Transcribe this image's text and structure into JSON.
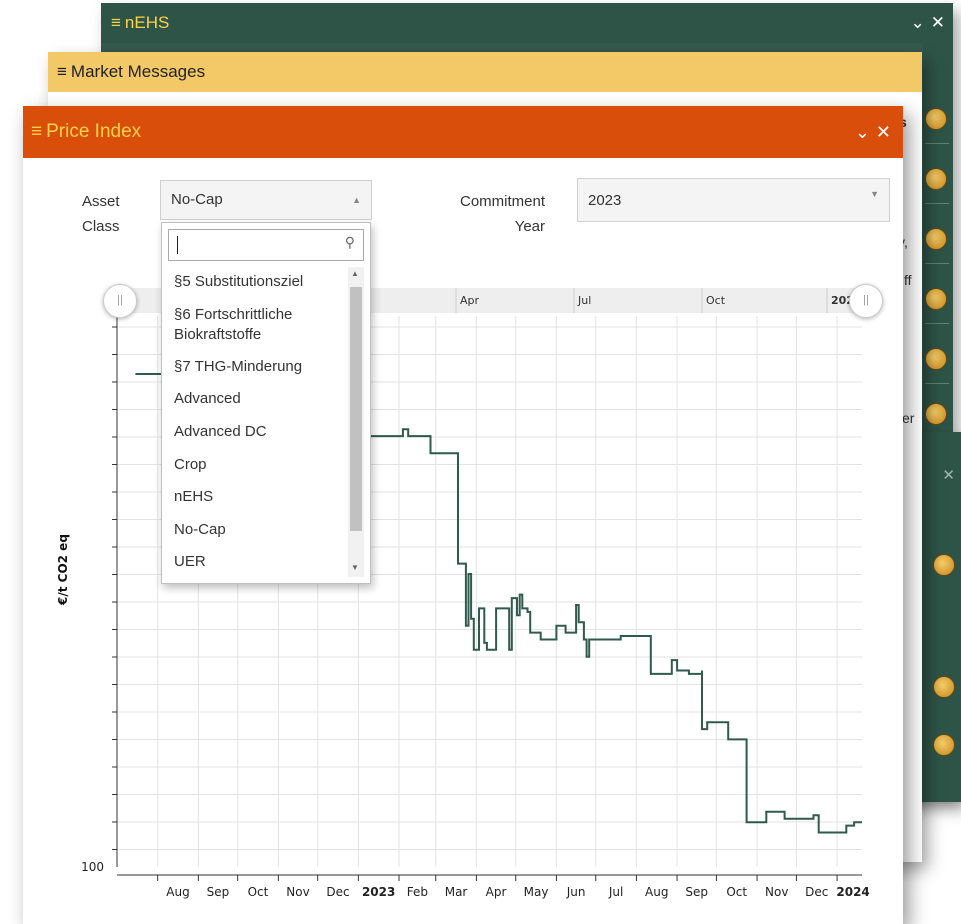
{
  "windows": {
    "nehs": {
      "title": "nEHS"
    },
    "market": {
      "title": "Market Messages",
      "partial_texts": [
        "s",
        "y,",
        "ff",
        "er"
      ]
    },
    "price": {
      "title": "Price Index",
      "asset_label": "Asset\nClass",
      "asset_value": "No-Cap",
      "commit_label": "Commitment\nYear",
      "commit_value": "2023",
      "search_value": "",
      "options": [
        "§5 Substitutionsziel",
        "§6 Fortschrittliche Biokraftstoffe",
        "§7 THG-Minderung",
        "Advanced",
        "Advanced DC",
        "Crop",
        "nEHS",
        "No-Cap",
        "UER"
      ]
    }
  },
  "icons": {
    "menu": "hamburger-icon",
    "collapse": "chevron-down-icon",
    "close": "close-icon",
    "search": "search-icon"
  },
  "colors": {
    "nehs_bar": "#2e5448",
    "market_bar": "#f3c866",
    "price_bar": "#d94e0b",
    "line": "#2f5a4d"
  },
  "chart_data": {
    "type": "line",
    "ylabel": "€/t CO2 eq",
    "y_tick_labels": [
      "100"
    ],
    "navigator_labels": [
      "Apr",
      "Jul",
      "Oct",
      "202"
    ],
    "x_tick_labels": [
      "Aug",
      "Sep",
      "Oct",
      "Nov",
      "Dec",
      "2023",
      "Feb",
      "Mar",
      "Apr",
      "May",
      "Jun",
      "Jul",
      "Aug",
      "Sep",
      "Oct",
      "Nov",
      "Dec",
      "2024"
    ],
    "series": [
      {
        "points": [
          [
            "2022-07-15",
            243
          ],
          [
            "2022-08-20",
            243
          ],
          [
            "2022-12-10",
            243
          ],
          [
            "2023-01-01",
            225
          ],
          [
            "2023-02-01",
            225
          ],
          [
            "2023-02-04",
            227
          ],
          [
            "2023-02-08",
            225
          ],
          [
            "2023-02-25",
            225
          ],
          [
            "2023-02-25",
            220
          ],
          [
            "2023-03-18",
            220
          ],
          [
            "2023-03-18",
            188
          ],
          [
            "2023-03-24",
            188
          ],
          [
            "2023-03-24",
            170
          ],
          [
            "2023-03-26",
            185
          ],
          [
            "2023-03-28",
            172
          ],
          [
            "2023-03-30",
            163
          ],
          [
            "2023-04-03",
            175
          ],
          [
            "2023-04-07",
            165
          ],
          [
            "2023-04-09",
            163
          ],
          [
            "2023-04-14",
            163
          ],
          [
            "2023-04-16",
            175
          ],
          [
            "2023-04-24",
            175
          ],
          [
            "2023-04-26",
            163
          ],
          [
            "2023-04-28",
            178
          ],
          [
            "2023-05-02",
            173
          ],
          [
            "2023-05-04",
            179
          ],
          [
            "2023-05-06",
            175
          ],
          [
            "2023-05-10",
            174
          ],
          [
            "2023-05-12",
            168
          ],
          [
            "2023-05-20",
            166
          ],
          [
            "2023-05-30",
            166
          ],
          [
            "2023-06-01",
            170
          ],
          [
            "2023-06-08",
            168
          ],
          [
            "2023-06-14",
            168
          ],
          [
            "2023-06-16",
            176
          ],
          [
            "2023-06-18",
            171
          ],
          [
            "2023-06-22",
            166
          ],
          [
            "2023-06-24",
            161
          ],
          [
            "2023-06-26",
            166
          ],
          [
            "2023-07-01",
            166
          ],
          [
            "2023-07-20",
            167
          ],
          [
            "2023-08-01",
            167
          ],
          [
            "2023-08-12",
            166
          ],
          [
            "2023-08-12",
            156
          ],
          [
            "2023-08-28",
            156
          ],
          [
            "2023-08-28",
            160
          ],
          [
            "2023-09-01",
            157
          ],
          [
            "2023-09-08",
            157
          ],
          [
            "2023-09-10",
            156
          ],
          [
            "2023-09-20",
            157
          ],
          [
            "2023-09-20",
            140
          ],
          [
            "2023-09-24",
            140
          ],
          [
            "2023-09-24",
            142
          ],
          [
            "2023-10-10",
            142
          ],
          [
            "2023-10-10",
            137
          ],
          [
            "2023-10-24",
            137
          ],
          [
            "2023-10-24",
            113
          ],
          [
            "2023-11-06",
            113
          ],
          [
            "2023-11-08",
            116
          ],
          [
            "2023-11-22",
            116
          ],
          [
            "2023-11-22",
            114
          ],
          [
            "2023-12-12",
            114
          ],
          [
            "2023-12-14",
            115
          ],
          [
            "2023-12-18",
            110
          ],
          [
            "2023-12-28",
            110
          ],
          [
            "2024-01-08",
            112
          ],
          [
            "2024-01-14",
            113
          ]
        ]
      }
    ]
  }
}
